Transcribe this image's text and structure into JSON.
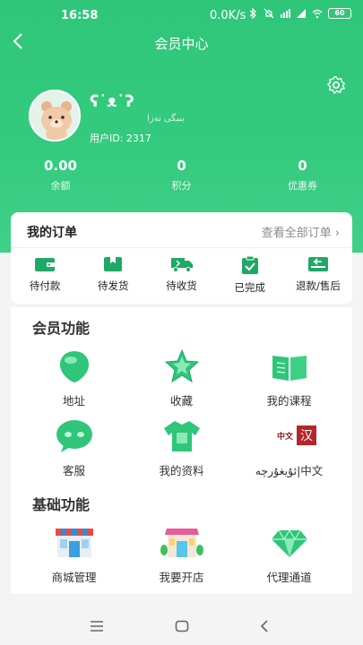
{
  "status": {
    "time": "16:58",
    "network_speed": "0.0K/s",
    "battery": "60",
    "icons": [
      "bluetooth-icon",
      "mute-icon",
      "hd-signal-icon",
      "signal-icon",
      "wifi-icon"
    ]
  },
  "nav": {
    "title": "会员中心",
    "back_icon": "back-arrow-icon",
    "settings_icon": "gear-icon"
  },
  "profile": {
    "nickname": "ʕ˙ᴥ˙ʔ",
    "sub_name": "بىبگى نەزا",
    "user_id_label": "用户ID:",
    "user_id": "2317",
    "avatar_icon": "bear-avatar-icon"
  },
  "stats": [
    {
      "value": "0.00",
      "label": "余额"
    },
    {
      "value": "0",
      "label": "积分"
    },
    {
      "value": "0",
      "label": "优惠券"
    }
  ],
  "orders": {
    "title": "我的订单",
    "view_all": "查看全部订单",
    "items": [
      {
        "label": "待付款",
        "icon": "wallet-icon"
      },
      {
        "label": "待发货",
        "icon": "package-icon"
      },
      {
        "label": "待收货",
        "icon": "truck-icon"
      },
      {
        "label": "已完成",
        "icon": "clipboard-check-icon"
      },
      {
        "label": "退款/售后",
        "icon": "refund-icon"
      }
    ]
  },
  "member_features": {
    "title": "会员功能",
    "items": [
      {
        "label": "地址",
        "icon": "location-icon"
      },
      {
        "label": "收藏",
        "icon": "star-icon"
      },
      {
        "label": "我的课程",
        "icon": "book-icon"
      },
      {
        "label": "客服",
        "icon": "chat-icon"
      },
      {
        "label": "我的资料",
        "icon": "shirt-icon"
      },
      {
        "label": "ئۇيغۇرچە|中文",
        "icon": "language-icon",
        "icon_text_left": "中文",
        "icon_text_right": "汉"
      }
    ]
  },
  "basic_features": {
    "title": "基础功能",
    "items": [
      {
        "label": "商城管理",
        "icon": "store-icon"
      },
      {
        "label": "我要开店",
        "icon": "shop-open-icon"
      },
      {
        "label": "代理通道",
        "icon": "diamond-icon"
      }
    ]
  },
  "colors": {
    "brand_green": "#2fc67a",
    "accent_red": "#b5262b"
  }
}
